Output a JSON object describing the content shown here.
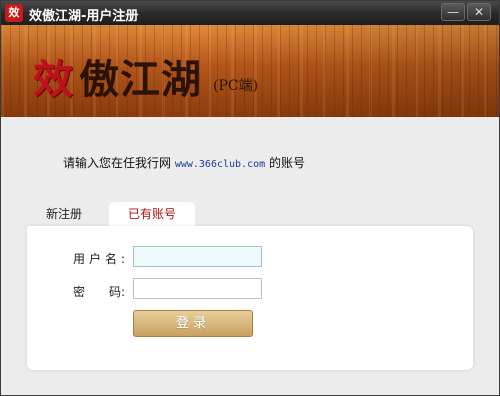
{
  "window": {
    "title": "效傲江湖-用户注册",
    "icon_char": "效",
    "minimize_label": "—",
    "close_label": "✕"
  },
  "banner": {
    "logo_red": "效",
    "logo_dark": "傲江湖",
    "logo_sub": "(PC端)"
  },
  "intro": {
    "text_before": "请输入您在任我行网 ",
    "site": "www.366club.com",
    "text_after": " 的账号"
  },
  "tabs": [
    {
      "label": "新注册",
      "active": false
    },
    {
      "label": "已有账号",
      "active": true
    }
  ],
  "form": {
    "username_label": "用户名:",
    "password_label": "密　　码:",
    "username_value": "",
    "password_value": "",
    "login_label": "登录"
  },
  "colors": {
    "accent": "#b01010",
    "button": "#c9a060",
    "title_bar": "#2b2b2b"
  }
}
